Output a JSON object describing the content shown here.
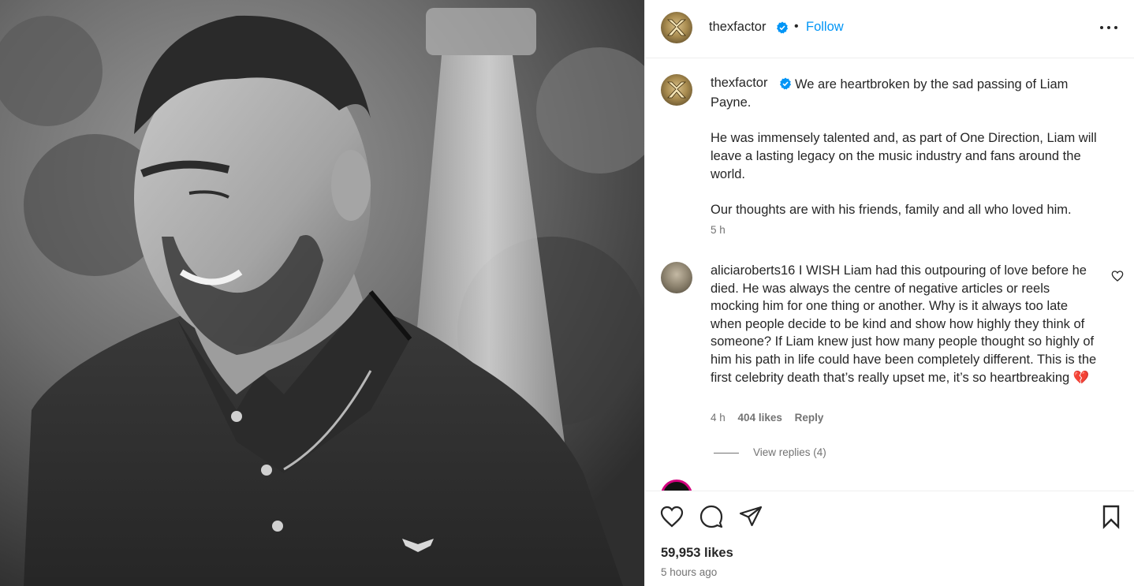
{
  "post": {
    "author": "thexfactor",
    "follow_label": "Follow",
    "separator": "•",
    "caption": {
      "line1": "We are heartbroken by the sad passing of Liam Payne.",
      "paragraph2": "He was immensely talented and, as part of One Direction, Liam will leave a lasting legacy on the music industry and fans around the world.",
      "paragraph3": "Our thoughts are with his friends, family and all who loved him.",
      "time": "5 h"
    },
    "likes": "59,953 likes",
    "posted_ago": "5 hours ago"
  },
  "comment": {
    "user": "aliciaroberts16",
    "text": "I WISH Liam had this outpouring of love before he died. He was always the centre of negative articles or reels mocking him for one thing or another. Why is it always too late when people decide to be kind and show how highly they think of someone? If Liam knew just how many people thought so highly of him his path in life could have been completely different. This is the first celebrity death that’s really upset me, it’s so heartbreaking",
    "emoji": "💔",
    "time": "4 h",
    "likes": "404 likes",
    "reply_label": "Reply",
    "view_replies": "View replies (4)"
  },
  "next_comment": {
    "text": "_____ ____ __ ____ _____ _____ __ ____"
  },
  "icons": {
    "like": "heart-icon",
    "comment": "comment-icon",
    "share": "share-icon",
    "save": "bookmark-icon",
    "more": "more-options-icon",
    "verified": "verified-badge-icon"
  },
  "colors": {
    "link": "#0095f6",
    "verified": "#0095f6",
    "secondary_text": "#737373",
    "emoji_heart": "#c8102e"
  }
}
